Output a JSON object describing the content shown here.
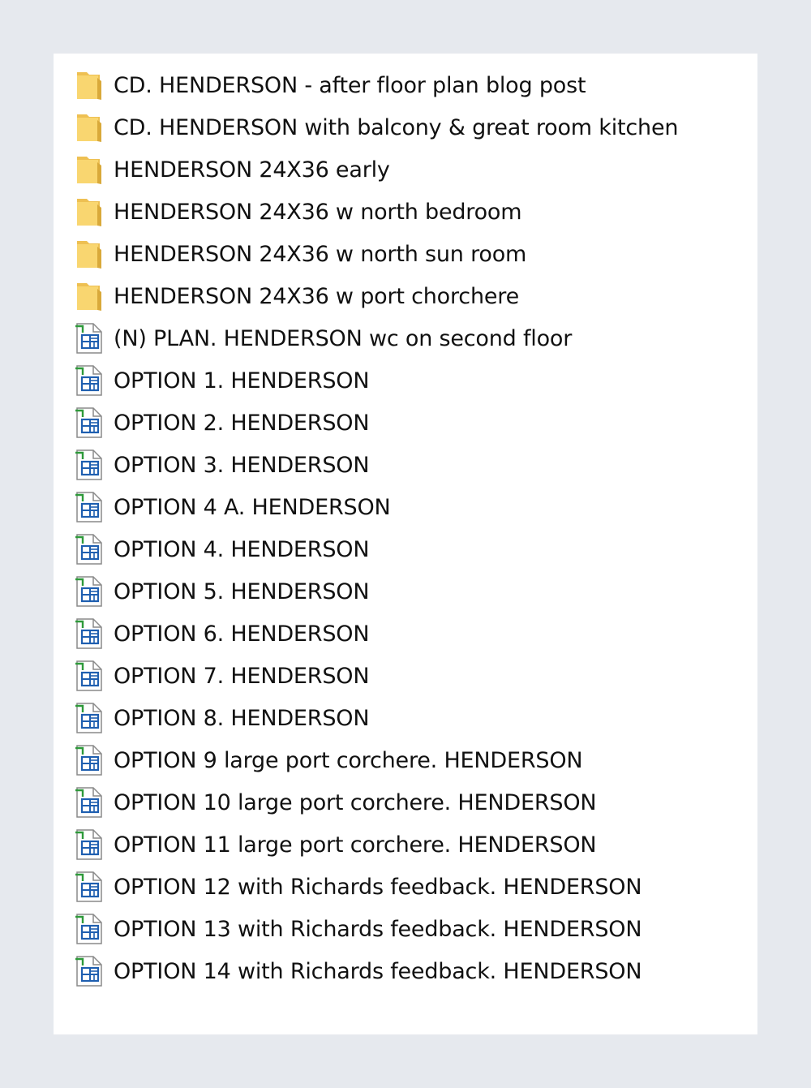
{
  "items": [
    {
      "type": "folder",
      "icon": "folder-icon",
      "name": "CD. HENDERSON - after floor plan blog post"
    },
    {
      "type": "folder",
      "icon": "folder-icon",
      "name": "CD. HENDERSON with balcony & great room kitchen"
    },
    {
      "type": "folder",
      "icon": "folder-icon",
      "name": "HENDERSON 24X36 early"
    },
    {
      "type": "folder",
      "icon": "folder-icon",
      "name": "HENDERSON 24X36 w north bedroom"
    },
    {
      "type": "folder",
      "icon": "folder-icon",
      "name": "HENDERSON 24X36 w north sun room"
    },
    {
      "type": "folder",
      "icon": "folder-icon",
      "name": "HENDERSON 24X36 w port chorchere"
    },
    {
      "type": "file",
      "icon": "floor-plan-file-icon",
      "name": "(N) PLAN. HENDERSON wc on second floor"
    },
    {
      "type": "file",
      "icon": "floor-plan-file-icon",
      "name": "OPTION 1. HENDERSON"
    },
    {
      "type": "file",
      "icon": "floor-plan-file-icon",
      "name": "OPTION 2. HENDERSON"
    },
    {
      "type": "file",
      "icon": "floor-plan-file-icon",
      "name": "OPTION 3. HENDERSON"
    },
    {
      "type": "file",
      "icon": "floor-plan-file-icon",
      "name": "OPTION 4 A. HENDERSON"
    },
    {
      "type": "file",
      "icon": "floor-plan-file-icon",
      "name": "OPTION 4. HENDERSON"
    },
    {
      "type": "file",
      "icon": "floor-plan-file-icon",
      "name": "OPTION 5. HENDERSON"
    },
    {
      "type": "file",
      "icon": "floor-plan-file-icon",
      "name": "OPTION 6. HENDERSON"
    },
    {
      "type": "file",
      "icon": "floor-plan-file-icon",
      "name": "OPTION 7. HENDERSON"
    },
    {
      "type": "file",
      "icon": "floor-plan-file-icon",
      "name": "OPTION 8. HENDERSON"
    },
    {
      "type": "file",
      "icon": "floor-plan-file-icon",
      "name": "OPTION 9 large port corchere. HENDERSON"
    },
    {
      "type": "file",
      "icon": "floor-plan-file-icon",
      "name": "OPTION 10 large port corchere. HENDERSON"
    },
    {
      "type": "file",
      "icon": "floor-plan-file-icon",
      "name": "OPTION 11 large port corchere. HENDERSON"
    },
    {
      "type": "file",
      "icon": "floor-plan-file-icon",
      "name": "OPTION 12 with Richards feedback. HENDERSON"
    },
    {
      "type": "file",
      "icon": "floor-plan-file-icon",
      "name": "OPTION 13 with Richards feedback. HENDERSON"
    },
    {
      "type": "file",
      "icon": "floor-plan-file-icon",
      "name": "OPTION 14 with Richards feedback. HENDERSON"
    }
  ],
  "colors": {
    "folder_fill": "#f9d670",
    "folder_tab": "#eec052",
    "file_green": "#2e9a3a",
    "file_blue": "#1f5fb0",
    "background": "#e6e9ee"
  }
}
